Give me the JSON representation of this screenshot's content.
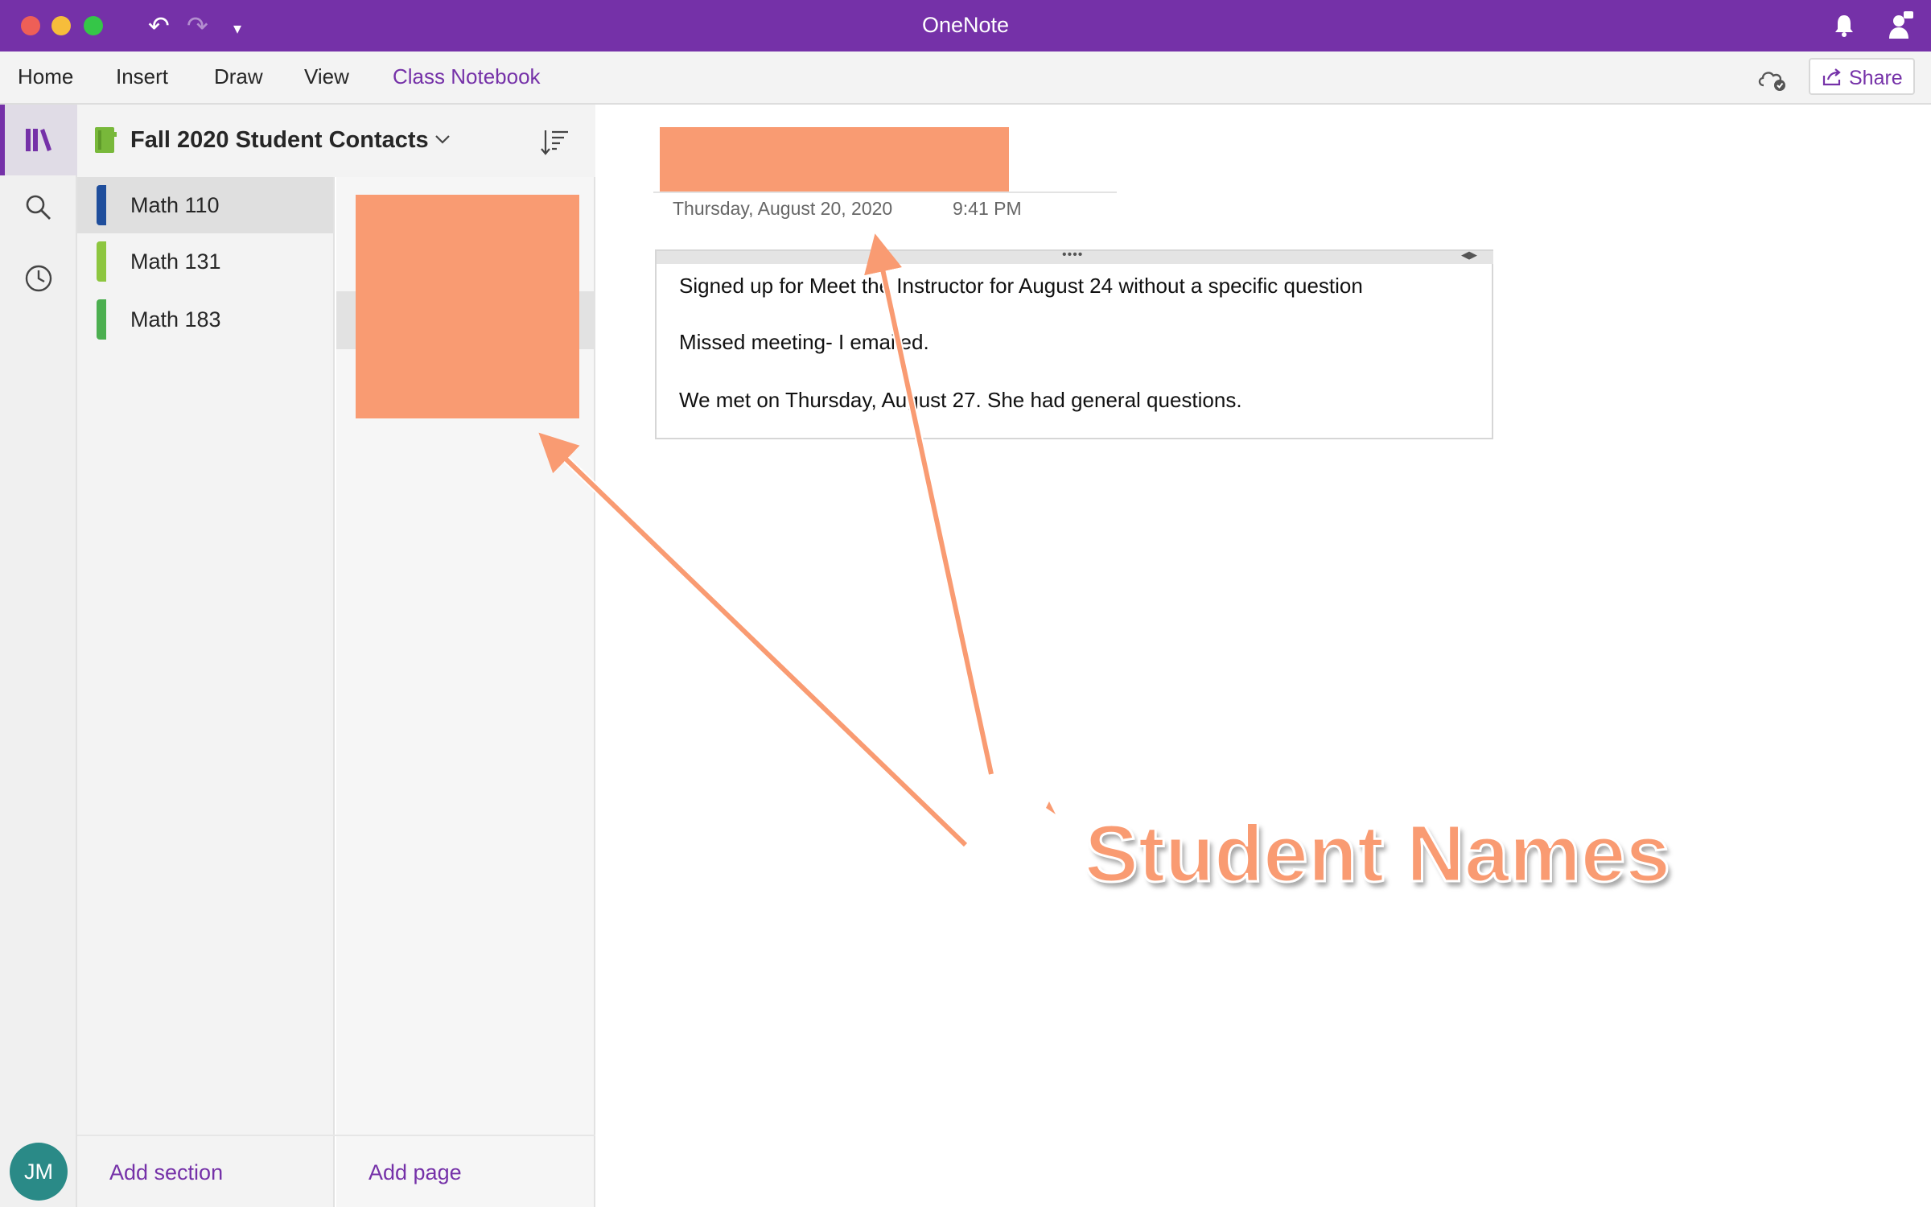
{
  "app": {
    "title": "OneNote",
    "accent": "#7531a8",
    "titlebar_icons": [
      "undo-icon",
      "redo-icon",
      "quick-access-dropdown-icon",
      "bell-icon",
      "person-icon"
    ]
  },
  "ribbon": {
    "tabs": [
      {
        "label": "Home",
        "active": false
      },
      {
        "label": "Insert",
        "active": false
      },
      {
        "label": "Draw",
        "active": false
      },
      {
        "label": "View",
        "active": false
      },
      {
        "label": "Class Notebook",
        "active": true
      }
    ],
    "share_label": "Share"
  },
  "rail": {
    "items": [
      "notebooks-icon",
      "search-icon",
      "recent-icon"
    ],
    "avatar_initials": "JM"
  },
  "notebook": {
    "title": "Fall 2020 Student Contacts",
    "color": "#78b83a",
    "sections": [
      {
        "name": "Math 110",
        "color": "#1f4e9c",
        "selected": true
      },
      {
        "name": "Math 131",
        "color": "#8dc63f",
        "selected": false
      },
      {
        "name": "Math 183",
        "color": "#4caf50",
        "selected": false
      }
    ],
    "add_section_label": "Add section",
    "add_page_label": "Add page"
  },
  "page": {
    "date": "Thursday, August 20, 2020",
    "time": "9:41 PM",
    "note_lines": [
      "Signed up for Meet the Instructor for August 24 without a specific question",
      "Missed meeting- I emailed.",
      "We met on Thursday, August 27. She had general questions."
    ]
  },
  "annotation": {
    "label": "Student Names",
    "color": "#f99b72"
  }
}
